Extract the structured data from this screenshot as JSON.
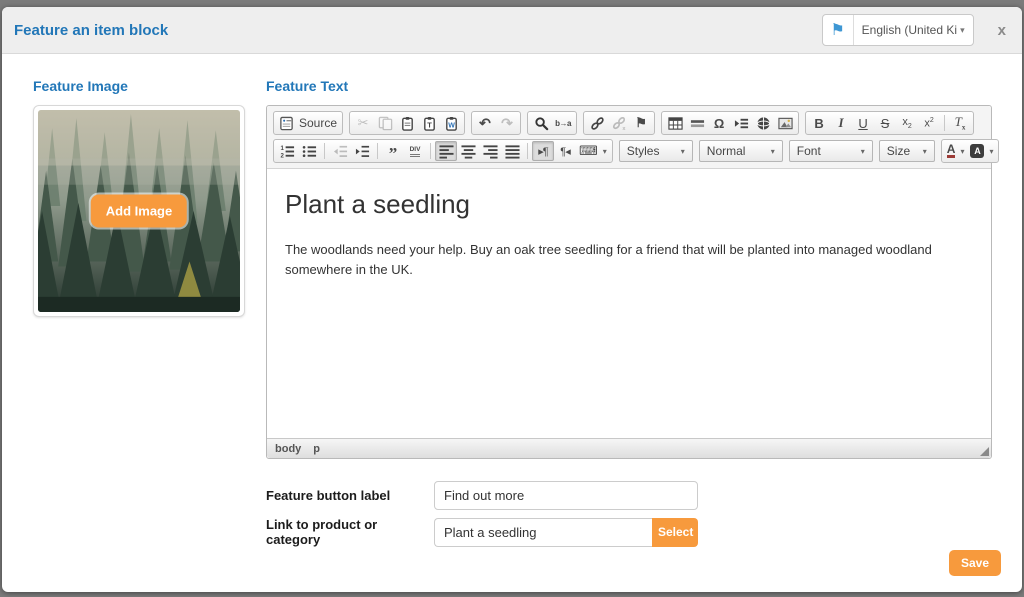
{
  "modal": {
    "title": "Feature an item block",
    "close_label": "x"
  },
  "language_selector": {
    "flag_icon": "flag-icon",
    "value": "English (United Ki...",
    "caret_icon": "caret-down-icon"
  },
  "feature_image": {
    "label": "Feature Image",
    "add_button_label": "Add Image"
  },
  "feature_text": {
    "label": "Feature Text",
    "editor": {
      "toolbar": {
        "rows": [
          {
            "groups": [
              {
                "name": "document-group",
                "items": [
                  {
                    "name": "source-button",
                    "icon": "source-icon",
                    "label": "Source",
                    "type": "labeled"
                  }
                ]
              },
              {
                "name": "clipboard-group",
                "items": [
                  {
                    "name": "cut-button",
                    "icon": "cut-icon",
                    "state": "disabled"
                  },
                  {
                    "name": "copy-button",
                    "icon": "copy-icon",
                    "state": "disabled"
                  },
                  {
                    "name": "paste-button",
                    "icon": "paste-icon"
                  },
                  {
                    "name": "paste-text-button",
                    "icon": "paste-text-icon"
                  },
                  {
                    "name": "paste-word-button",
                    "icon": "paste-word-icon"
                  }
                ]
              },
              {
                "name": "undo-group",
                "items": [
                  {
                    "name": "undo-button",
                    "icon": "undo-icon"
                  },
                  {
                    "name": "redo-button",
                    "icon": "redo-icon",
                    "state": "disabled"
                  }
                ]
              },
              {
                "name": "find-group",
                "items": [
                  {
                    "name": "find-button",
                    "icon": "find-icon"
                  },
                  {
                    "name": "replace-button",
                    "icon": "replace-icon"
                  }
                ]
              },
              {
                "name": "links-group",
                "items": [
                  {
                    "name": "link-button",
                    "icon": "link-icon"
                  },
                  {
                    "name": "unlink-button",
                    "icon": "unlink-icon",
                    "state": "disabled"
                  },
                  {
                    "name": "anchor-button",
                    "icon": "anchor-icon"
                  }
                ]
              },
              {
                "name": "insert-group",
                "items": [
                  {
                    "name": "table-button",
                    "icon": "table-icon"
                  },
                  {
                    "name": "horizontal-rule-button",
                    "icon": "hr-icon"
                  },
                  {
                    "name": "special-char-button",
                    "icon": "specialchar-icon"
                  },
                  {
                    "name": "page-break-button",
                    "icon": "pagebreak-icon"
                  },
                  {
                    "name": "iframe-button",
                    "icon": "iframe-icon"
                  },
                  {
                    "name": "image-button",
                    "icon": "image-icon"
                  }
                ]
              },
              {
                "name": "basicstyles-group",
                "items": [
                  {
                    "name": "bold-button",
                    "icon": "bold-icon"
                  },
                  {
                    "name": "italic-button",
                    "icon": "italic-icon"
                  },
                  {
                    "name": "underline-button",
                    "icon": "underline-icon"
                  },
                  {
                    "name": "strikethrough-button",
                    "icon": "strike-icon"
                  },
                  {
                    "name": "subscript-button",
                    "icon": "subscript-icon"
                  },
                  {
                    "name": "superscript-button",
                    "icon": "superscript-icon"
                  },
                  {
                    "type": "sep"
                  },
                  {
                    "name": "remove-format-button",
                    "icon": "removeformat-icon"
                  }
                ]
              }
            ]
          },
          {
            "groups": [
              {
                "name": "paragraph-group",
                "items": [
                  {
                    "name": "numbered-list-button",
                    "icon": "numbered-list-icon"
                  },
                  {
                    "name": "bulleted-list-button",
                    "icon": "bulleted-list-icon"
                  },
                  {
                    "type": "sep"
                  },
                  {
                    "name": "outdent-button",
                    "icon": "outdent-icon",
                    "state": "disabled"
                  },
                  {
                    "name": "indent-button",
                    "icon": "indent-icon"
                  },
                  {
                    "type": "sep"
                  },
                  {
                    "name": "blockquote-button",
                    "icon": "blockquote-icon"
                  },
                  {
                    "name": "div-container-button",
                    "icon": "div-icon"
                  },
                  {
                    "type": "sep"
                  },
                  {
                    "name": "align-left-button",
                    "icon": "align-left-icon",
                    "state": "active"
                  },
                  {
                    "name": "align-center-button",
                    "icon": "align-center-icon"
                  },
                  {
                    "name": "align-right-button",
                    "icon": "align-right-icon"
                  },
                  {
                    "name": "align-justify-button",
                    "icon": "align-justify-icon"
                  },
                  {
                    "type": "sep"
                  },
                  {
                    "name": "bidi-ltr-button",
                    "icon": "bidi-ltr-icon",
                    "state": "active"
                  },
                  {
                    "name": "bidi-rtl-button",
                    "icon": "bidi-rtl-icon"
                  },
                  {
                    "name": "language-button",
                    "icon": "language-icon",
                    "type": "combo"
                  }
                ]
              },
              {
                "name": "styles-group",
                "noframe": true,
                "items": [
                  {
                    "name": "styles-dropdown",
                    "label": "Styles",
                    "type": "select"
                  }
                ]
              },
              {
                "name": "format-group",
                "noframe": true,
                "items": [
                  {
                    "name": "format-dropdown",
                    "label": "Normal",
                    "type": "select"
                  }
                ]
              },
              {
                "name": "font-group",
                "noframe": true,
                "items": [
                  {
                    "name": "font-dropdown",
                    "label": "Font",
                    "type": "select"
                  }
                ]
              },
              {
                "name": "size-group",
                "noframe": true,
                "items": [
                  {
                    "name": "size-dropdown",
                    "label": "Size",
                    "type": "select"
                  }
                ]
              },
              {
                "name": "colors-group",
                "items": [
                  {
                    "name": "text-color-button",
                    "icon": "text-color-icon",
                    "type": "combo"
                  },
                  {
                    "name": "bg-color-button",
                    "icon": "bg-color-icon",
                    "type": "combo"
                  }
                ]
              }
            ]
          }
        ]
      },
      "content": {
        "heading": "Plant a seedling",
        "paragraph": "The woodlands need your help. Buy an oak tree seedling for a friend that will be planted into managed woodland somewhere in the UK."
      },
      "status_bar": {
        "elements": [
          "body",
          "p"
        ]
      }
    }
  },
  "fields": {
    "button_label": {
      "label": "Feature button label",
      "value": "Find out more"
    },
    "link": {
      "label": "Link to product or category",
      "value": "Plant a seedling",
      "select_button_label": "Select"
    }
  },
  "save_button_label": "Save",
  "colors": {
    "accent_orange": "#f79a3d",
    "title_blue": "#2277b8",
    "header_background": "#eeeeee",
    "overlay_background": "#7b7b7b",
    "flag_blue": "#3e97d4"
  }
}
